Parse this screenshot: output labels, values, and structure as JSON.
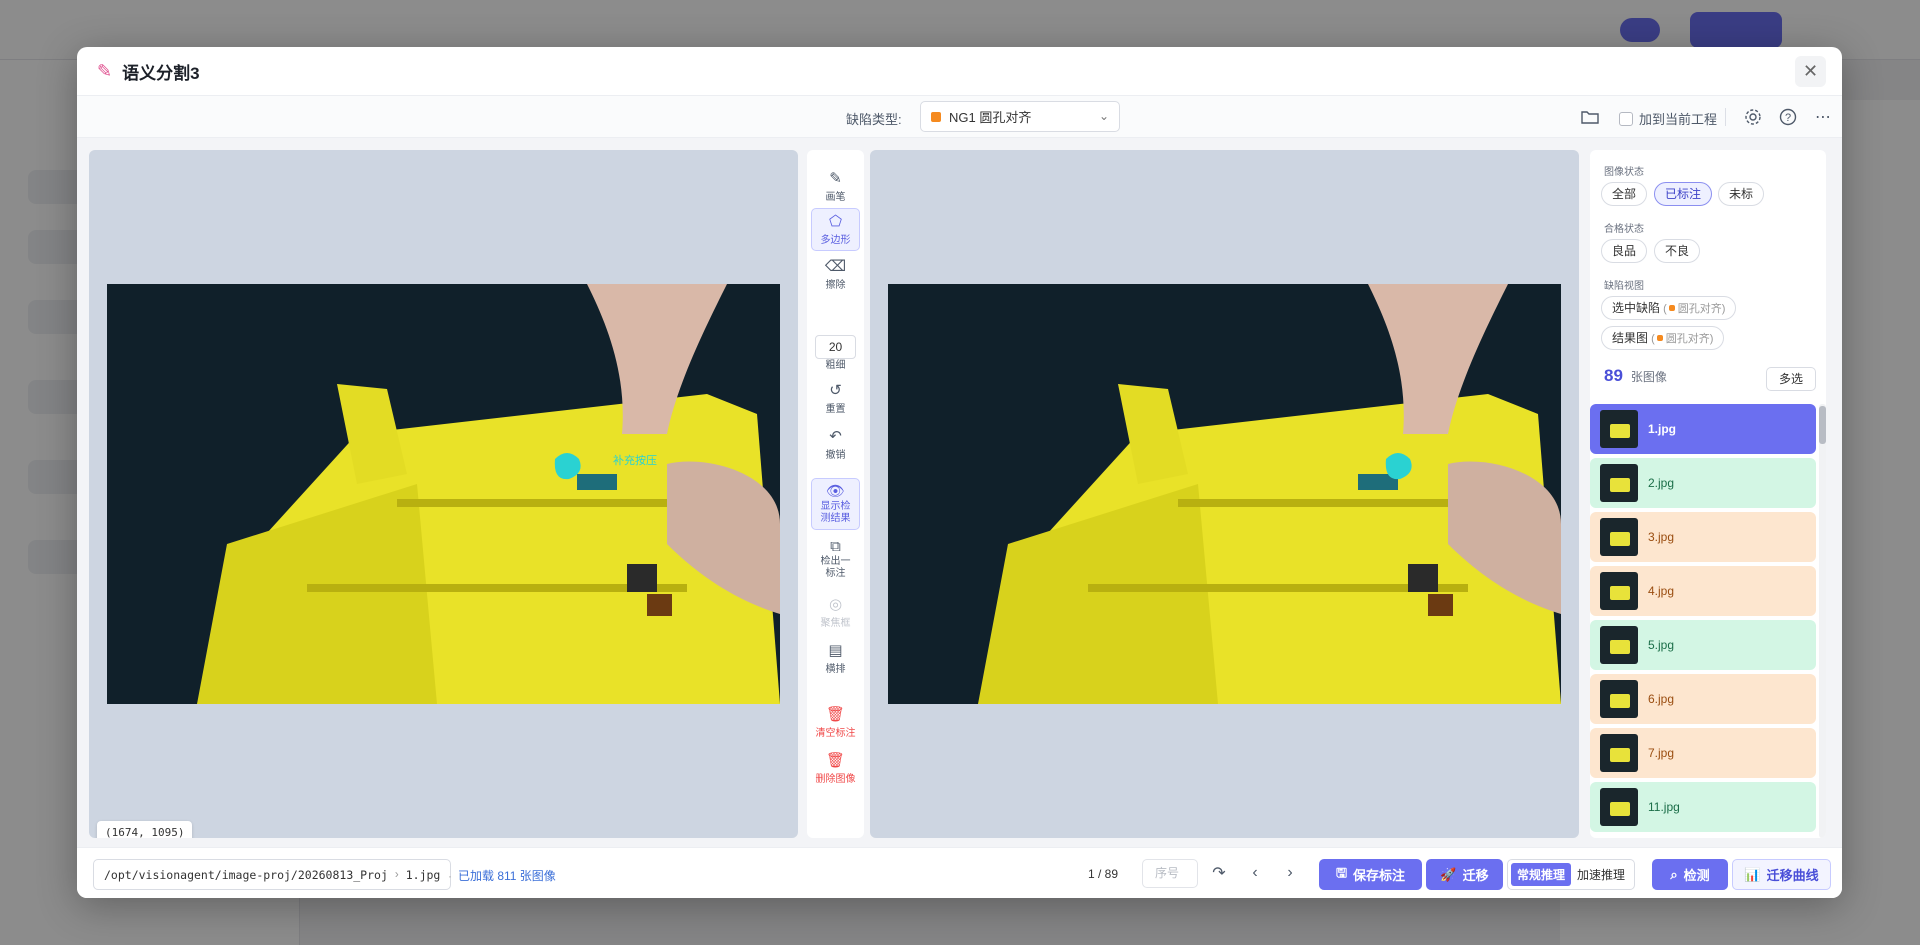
{
  "modal": {
    "title": "语义分割3",
    "close_icon": "close-icon"
  },
  "toolbar": {
    "defect_label": "缺陷类型:",
    "defect_value": "NG1 圆孔对齐",
    "defect_color": "#f58a1f",
    "add_to_project": "加到当前工程"
  },
  "tools": [
    {
      "label": "画笔",
      "icon": "brush-icon"
    },
    {
      "label": "多边形",
      "icon": "polygon-icon",
      "active": true
    },
    {
      "label": "擦除",
      "icon": "eraser-icon"
    },
    {
      "label": "粗细",
      "icon": "thickness-icon"
    },
    {
      "label": "重置",
      "icon": "reset-icon"
    },
    {
      "label": "撤销",
      "icon": "undo-icon"
    },
    {
      "label": "显示检测结果",
      "icon": "eye-icon",
      "active": true
    },
    {
      "label": "检出一标注",
      "icon": "copy-icon"
    },
    {
      "label": "聚焦框",
      "icon": "target-icon",
      "disabled": true
    },
    {
      "label": "横排",
      "icon": "layout-icon"
    },
    {
      "label": "清空标注",
      "icon": "trash-icon",
      "danger": true
    },
    {
      "label": "删除图像",
      "icon": "trash-icon",
      "danger": true
    }
  ],
  "brush_size": "20",
  "annotation_label": "补充按压",
  "coordinate": "(1674, 1095)",
  "right_panel": {
    "image_status_label": "图像状态",
    "image_status_chips": [
      "全部",
      "已标注",
      "未标"
    ],
    "quality_label": "合格状态",
    "quality_chips": [
      "良品",
      "不良"
    ],
    "defect_view_label": "缺陷视图",
    "selected_defect": "选中缺陷",
    "result_image": "结果图",
    "defect_short": "圆孔对齐",
    "image_count": "89",
    "image_count_unit": "张图像",
    "multi_select": "多选",
    "images": [
      {
        "name": "1.jpg",
        "state": "sel"
      },
      {
        "name": "2.jpg",
        "state": "ok"
      },
      {
        "name": "3.jpg",
        "state": "ng"
      },
      {
        "name": "4.jpg",
        "state": "ng"
      },
      {
        "name": "5.jpg",
        "state": "ok"
      },
      {
        "name": "6.jpg",
        "state": "ng"
      },
      {
        "name": "7.jpg",
        "state": "ng"
      },
      {
        "name": "11.jpg",
        "state": "ok"
      }
    ]
  },
  "footer": {
    "path": "/opt/visionagent/image-proj/20260813_Proj",
    "file": "1.jpg",
    "loaded": "已加载 811 张图像",
    "pager": "1 / 89",
    "seq_placeholder": "序号",
    "save": "保存标注",
    "migrate": "迁移",
    "infer_normal": "常规推理",
    "infer_fast": "加速推理",
    "detect": "检测",
    "migrate_curve": "迁移曲线"
  }
}
